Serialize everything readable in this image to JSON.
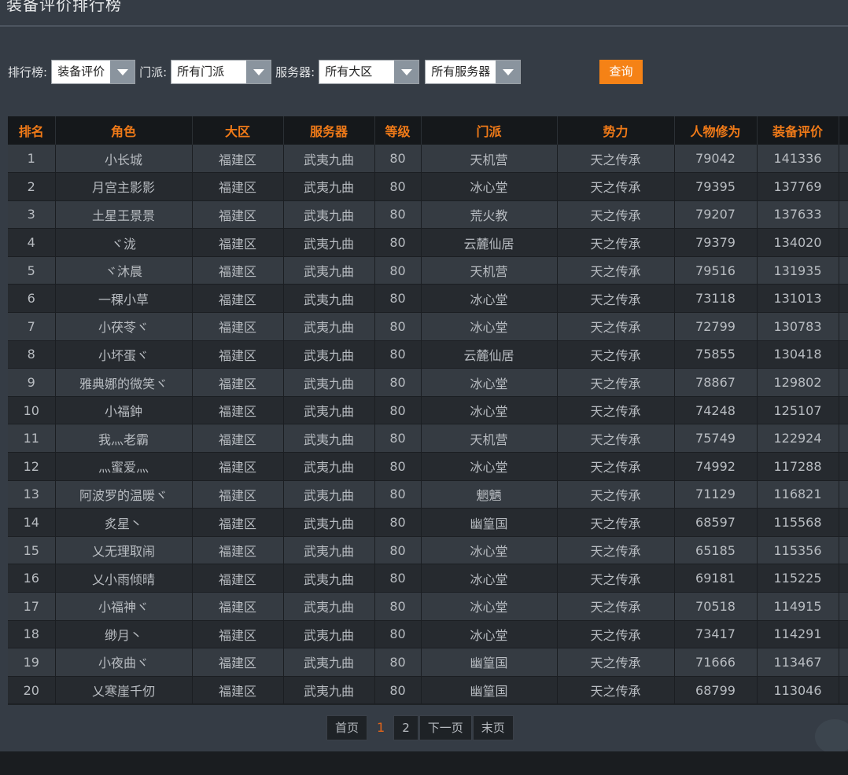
{
  "header": {
    "title": "装备评价排行榜"
  },
  "filters": {
    "rank_label": "排行榜:",
    "rank_value": "装备评价",
    "sect_label": "门派:",
    "sect_value": "所有门派",
    "server_label": "服务器:",
    "region_value": "所有大区",
    "server_value": "所有服务器",
    "query_label": "查询"
  },
  "table": {
    "columns": [
      "排名",
      "角色",
      "大区",
      "服务器",
      "等级",
      "门派",
      "势力",
      "人物修为",
      "装备评价"
    ],
    "rows": [
      [
        "1",
        "小长城",
        "福建区",
        "武夷九曲",
        "80",
        "天机营",
        "天之传承",
        "79042",
        "141336"
      ],
      [
        "2",
        "月宫主影影",
        "福建区",
        "武夷九曲",
        "80",
        "冰心堂",
        "天之传承",
        "79395",
        "137769"
      ],
      [
        "3",
        "土星王景景",
        "福建区",
        "武夷九曲",
        "80",
        "荒火教",
        "天之传承",
        "79207",
        "137633"
      ],
      [
        "4",
        "ヾ泷",
        "福建区",
        "武夷九曲",
        "80",
        "云麓仙居",
        "天之传承",
        "79379",
        "134020"
      ],
      [
        "5",
        "ヾ沐晨",
        "福建区",
        "武夷九曲",
        "80",
        "天机营",
        "天之传承",
        "79516",
        "131935"
      ],
      [
        "6",
        "一稞小草",
        "福建区",
        "武夷九曲",
        "80",
        "冰心堂",
        "天之传承",
        "73118",
        "131013"
      ],
      [
        "7",
        "小茯苓ヾ",
        "福建区",
        "武夷九曲",
        "80",
        "冰心堂",
        "天之传承",
        "72799",
        "130783"
      ],
      [
        "8",
        "小坏蛋ヾ",
        "福建区",
        "武夷九曲",
        "80",
        "云麓仙居",
        "天之传承",
        "75855",
        "130418"
      ],
      [
        "9",
        "雅典娜的微笑ヾ",
        "福建区",
        "武夷九曲",
        "80",
        "冰心堂",
        "天之传承",
        "78867",
        "129802"
      ],
      [
        "10",
        "小福鈡",
        "福建区",
        "武夷九曲",
        "80",
        "冰心堂",
        "天之传承",
        "74248",
        "125107"
      ],
      [
        "11",
        "我灬老霸",
        "福建区",
        "武夷九曲",
        "80",
        "天机营",
        "天之传承",
        "75749",
        "122924"
      ],
      [
        "12",
        "灬蜜爱灬",
        "福建区",
        "武夷九曲",
        "80",
        "冰心堂",
        "天之传承",
        "74992",
        "117288"
      ],
      [
        "13",
        "阿波罗的温暖ヾ",
        "福建区",
        "武夷九曲",
        "80",
        "魍魉",
        "天之传承",
        "71129",
        "116821"
      ],
      [
        "14",
        "炙星丶",
        "福建区",
        "武夷九曲",
        "80",
        "幽篁国",
        "天之传承",
        "68597",
        "115568"
      ],
      [
        "15",
        "乂无理取闹",
        "福建区",
        "武夷九曲",
        "80",
        "冰心堂",
        "天之传承",
        "65185",
        "115356"
      ],
      [
        "16",
        "乂小雨倾晴",
        "福建区",
        "武夷九曲",
        "80",
        "冰心堂",
        "天之传承",
        "69181",
        "115225"
      ],
      [
        "17",
        "小福神ヾ",
        "福建区",
        "武夷九曲",
        "80",
        "冰心堂",
        "天之传承",
        "70518",
        "114915"
      ],
      [
        "18",
        "缈月丶",
        "福建区",
        "武夷九曲",
        "80",
        "冰心堂",
        "天之传承",
        "73417",
        "114291"
      ],
      [
        "19",
        "小夜曲ヾ",
        "福建区",
        "武夷九曲",
        "80",
        "幽篁国",
        "天之传承",
        "71666",
        "113467"
      ],
      [
        "20",
        "乂寒崖千仞",
        "福建区",
        "武夷九曲",
        "80",
        "幽篁国",
        "天之传承",
        "68799",
        "113046"
      ]
    ]
  },
  "pager": {
    "first": "首页",
    "current": "1",
    "page2": "2",
    "next": "下一页",
    "last": "末页"
  }
}
